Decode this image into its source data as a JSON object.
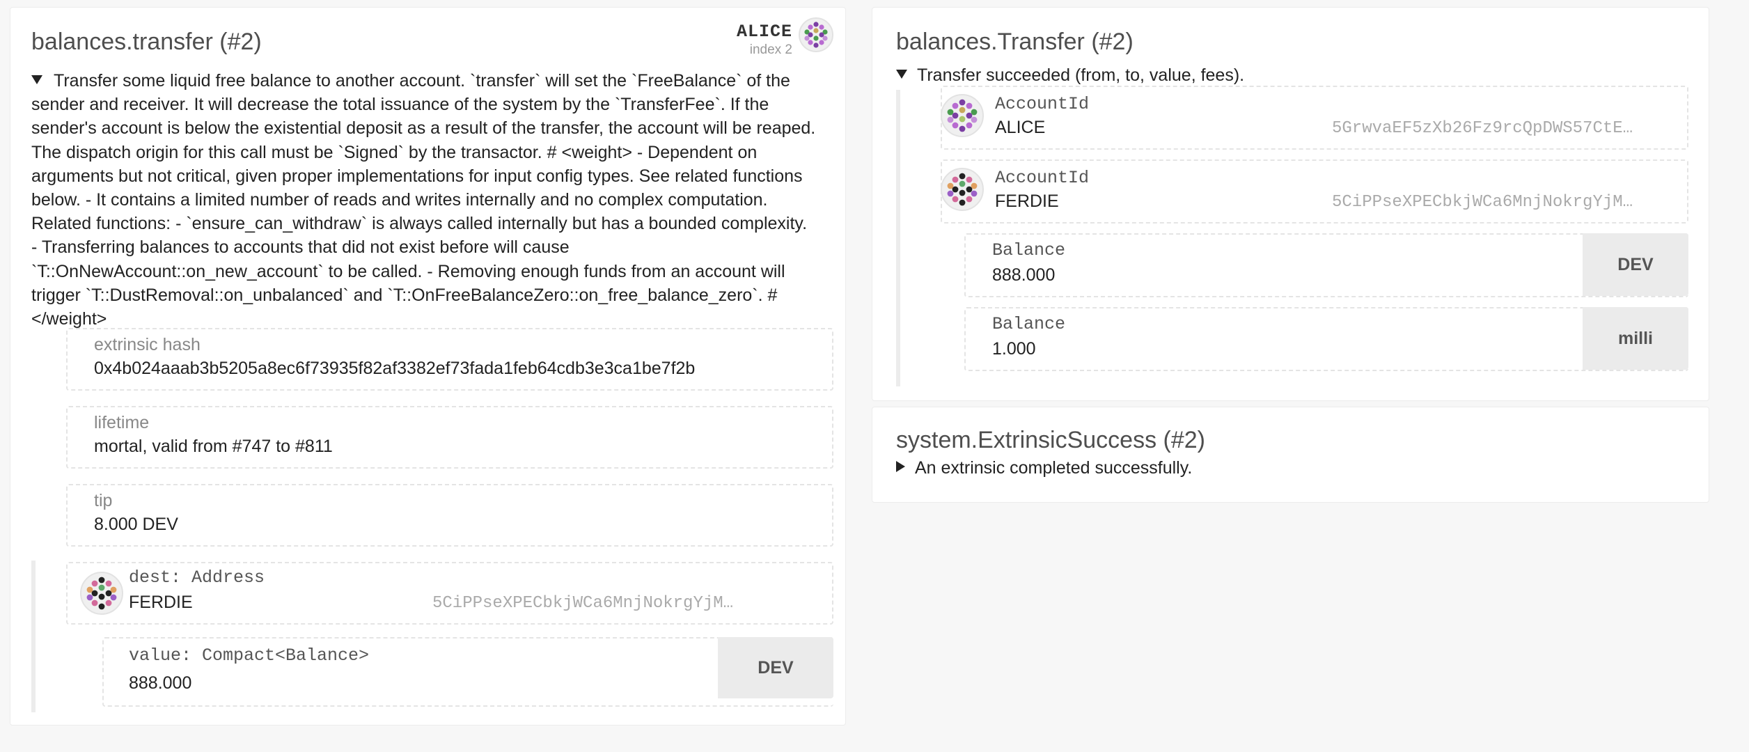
{
  "extrinsic": {
    "title": "balances.transfer (#2)",
    "signer": {
      "name": "ALICE",
      "index": "index 2"
    },
    "doc_lines": [
      "Transfer some liquid free balance to another account. `transfer` will set the `FreeBalance` of the",
      "sender and receiver. It will decrease the total issuance of the system by the `TransferFee`. If the",
      "sender's account is below the existential deposit as a result of the transfer, the account will be reaped.",
      "The dispatch origin for this call must be `Signed` by the transactor. # <weight> - Dependent on",
      "arguments but not critical, given proper implementations for input config types. See related functions",
      "below. - It contains a limited number of reads and writes internally and no complex computation.",
      "Related functions: - `ensure_can_withdraw` is always called internally but has a bounded complexity.",
      "- Transferring balances to accounts that did not exist before will cause",
      "`T::OnNewAccount::on_new_account` to be called. - Removing enough funds from an account will",
      "trigger `T::DustRemoval::on_unbalanced` and `T::OnFreeBalanceZero::on_free_balance_zero`. #",
      "</weight>"
    ],
    "hash": {
      "label": "extrinsic hash",
      "value": "0x4b024aaab3b5205a8ec6f73935f82af3382ef73fada1feb64cdb3e3ca1be7f2b"
    },
    "lifetime": {
      "label": "lifetime",
      "value": "mortal, valid from #747 to #811"
    },
    "tip": {
      "label": "tip",
      "value": "8.000 DEV"
    },
    "dest": {
      "label": "dest: Address",
      "name": "FERDIE",
      "address": "5CiPPseXPECbkjWCa6MnjNokrgYjM…"
    },
    "value": {
      "label": "value: Compact<Balance>",
      "amount": "888.000",
      "unit": "DEV"
    }
  },
  "events": [
    {
      "title": "balances.Transfer (#2)",
      "summary": "Transfer succeeded (from, to, value, fees).",
      "expanded": true,
      "from": {
        "label": "AccountId",
        "name": "ALICE",
        "address": "5GrwvaEF5zXb26Fz9rcQpDWS57CtE…"
      },
      "to": {
        "label": "AccountId",
        "name": "FERDIE",
        "address": "5CiPPseXPECbkjWCa6MnjNokrgYjM…"
      },
      "value": {
        "label": "Balance",
        "amount": "888.000",
        "unit": "DEV"
      },
      "fees": {
        "label": "Balance",
        "amount": "1.000",
        "unit": "milli"
      }
    },
    {
      "title": "system.ExtrinsicSuccess (#2)",
      "summary": "An extrinsic completed successfully.",
      "expanded": false
    }
  ],
  "icons": {
    "alice": "identicon-icon",
    "ferdie": "identicon-icon",
    "expand": "triangle-down-icon",
    "collapse": "triangle-right-icon"
  },
  "colors": {
    "background": "#f7f7f7",
    "card": "#ffffff",
    "dashed_border": "#e4e4e4",
    "unit_box": "#ebebeb",
    "address_muted": "#aaaaaa"
  }
}
